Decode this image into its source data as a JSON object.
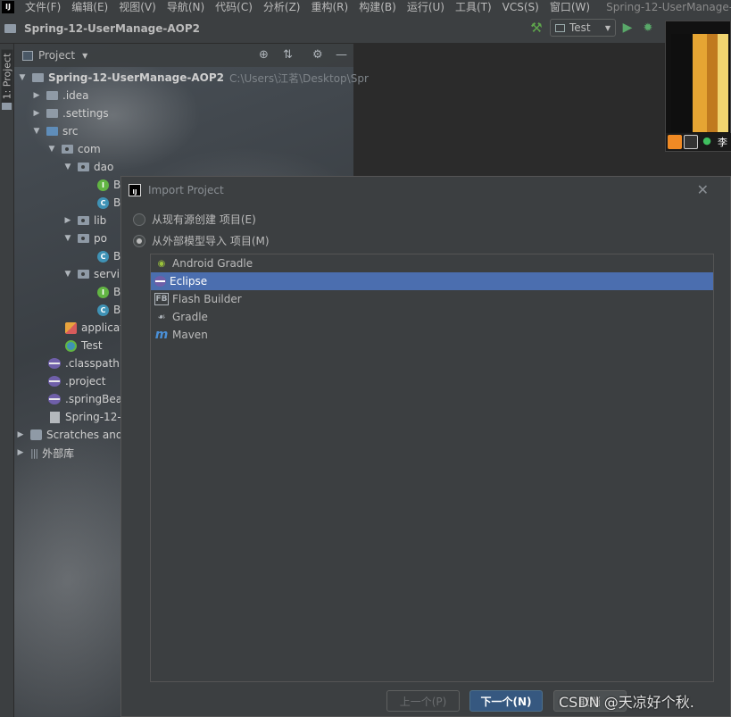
{
  "menubar": {
    "items": [
      "文件(F)",
      "编辑(E)",
      "视图(V)",
      "导航(N)",
      "代码(C)",
      "分析(Z)",
      "重构(R)",
      "构建(B)",
      "运行(U)",
      "工具(T)",
      "VCS(S)",
      "窗口(W)"
    ],
    "window_title": "Spring-12-UserManage-AOP"
  },
  "navbar": {
    "project_name": "Spring-12-UserManage-AOP2",
    "run_config": "Test"
  },
  "tool_strip": {
    "label": "1: Project"
  },
  "project_panel": {
    "title": "Project",
    "tree": [
      {
        "label": "Spring-12-UserManage-AOP2",
        "hint": "C:\\Users\\江茗\\Desktop\\Spr",
        "bold": true
      },
      {
        "label": ".idea"
      },
      {
        "label": ".settings"
      },
      {
        "label": "src"
      },
      {
        "label": "com"
      },
      {
        "label": "dao"
      },
      {
        "label": "B"
      },
      {
        "label": "B"
      },
      {
        "label": "lib"
      },
      {
        "label": "po"
      },
      {
        "label": "B"
      },
      {
        "label": "servi"
      },
      {
        "label": "B"
      },
      {
        "label": "B"
      },
      {
        "label": "applicat"
      },
      {
        "label": "Test"
      },
      {
        "label": ".classpath"
      },
      {
        "label": ".project"
      },
      {
        "label": ".springBea"
      },
      {
        "label": "Spring-12-"
      },
      {
        "label": "Scratches and"
      },
      {
        "label": "外部库"
      }
    ]
  },
  "video": {
    "name": "李"
  },
  "dialog": {
    "title": "Import Project",
    "radio_existing": "从现有源创建 项目(E)",
    "radio_external": "从外部模型导入 项目(M)",
    "models": [
      "Android Gradle",
      "Eclipse",
      "Flash Builder",
      "Gradle",
      "Maven"
    ],
    "selected_model": "Eclipse",
    "prev_button": "上一个(P)",
    "next_button": "下一个(N)",
    "cancel_button": "取消"
  },
  "watermark": "CSDN @天凉好个秋."
}
